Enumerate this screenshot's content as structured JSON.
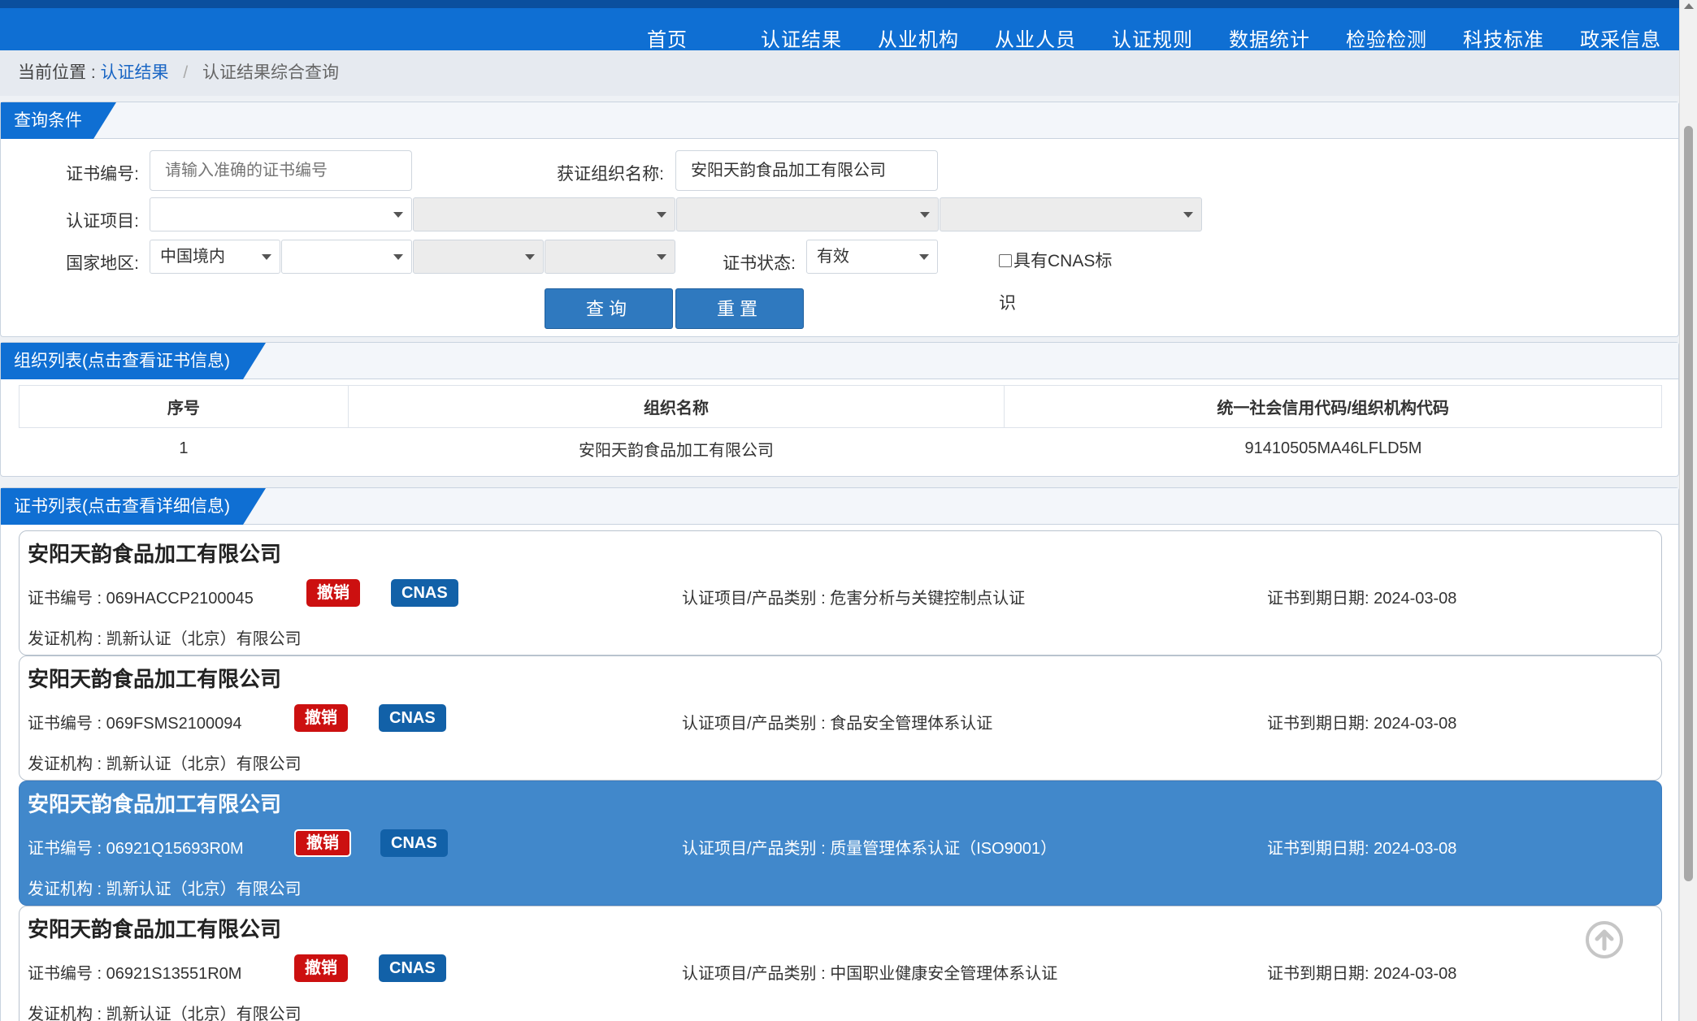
{
  "nav": {
    "items": [
      "首页",
      "认证结果",
      "从业机构",
      "从业人员",
      "认证规则",
      "数据统计",
      "检验检测",
      "科技标准",
      "政采信息"
    ]
  },
  "breadcrumb": {
    "prefix": "当前位置 :",
    "link": "认证结果",
    "separator": "/",
    "current": "认证结果综合查询"
  },
  "query": {
    "title": "查询条件",
    "cert_no_label": "证书编号:",
    "cert_no_placeholder": "请输入准确的证书编号",
    "org_label": "获证组织名称:",
    "org_value": "安阳天韵食品加工有限公司",
    "project_label": "认证项目:",
    "region_label": "国家地区:",
    "region_value": "中国境内",
    "status_label": "证书状态:",
    "status_value": "有效",
    "cnas_label_1": "具有CNAS标",
    "cnas_label_2": "识",
    "search_button": "查询",
    "reset_button": "重置"
  },
  "orgs": {
    "title": "组织列表(点击查看证书信息)",
    "columns": [
      "序号",
      "组织名称",
      "统一社会信用代码/组织机构代码"
    ],
    "rows": [
      [
        "1",
        "安阳天韵食品加工有限公司",
        "91410505MA46LFLD5M"
      ]
    ]
  },
  "certs": {
    "title": "证书列表(点击查看详细信息)",
    "revoked_badge": "撤销",
    "cnas_badge": "CNAS",
    "items": [
      {
        "org": "安阳天韵食品加工有限公司",
        "cert_no": "证书编号 : 069HACCP2100045",
        "project": "认证项目/产品类别 : 危害分析与关键控制点认证",
        "expiry": "证书到期日期: 2024-03-08",
        "issuer": "发证机构 : 凯新认证（北京）有限公司"
      },
      {
        "org": "安阳天韵食品加工有限公司",
        "cert_no": "证书编号 : 069FSMS2100094",
        "project": "认证项目/产品类别 : 食品安全管理体系认证",
        "expiry": "证书到期日期: 2024-03-08",
        "issuer": "发证机构 : 凯新认证（北京）有限公司"
      },
      {
        "org": "安阳天韵食品加工有限公司",
        "cert_no": "证书编号 : 06921Q15693R0M",
        "project": "认证项目/产品类别 : 质量管理体系认证（ISO9001）",
        "expiry": "证书到期日期: 2024-03-08",
        "issuer": "发证机构 : 凯新认证（北京）有限公司"
      },
      {
        "org": "安阳天韵食品加工有限公司",
        "cert_no": "证书编号 : 06921S13551R0M",
        "project": "认证项目/产品类别 : 中国职业健康安全管理体系认证",
        "expiry": "证书到期日期: 2024-03-08",
        "issuer": "发证机构 : 凯新认证（北京）有限公司"
      }
    ]
  },
  "colors": {
    "nav_bg": "#0f6fd3",
    "active_card": "#4188cb",
    "revoked": "#cc1010",
    "cnas": "#1261a8",
    "button": "#2f79bf"
  },
  "icons": {
    "back_to_top": "arrow-up-circle-icon",
    "select_caret": "caret-down-icon"
  }
}
